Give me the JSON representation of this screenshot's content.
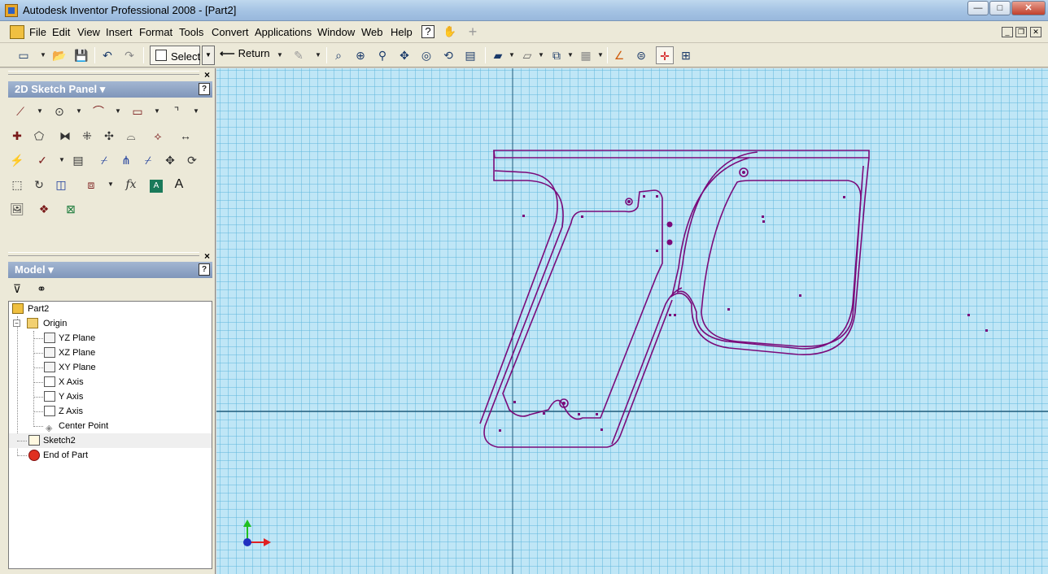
{
  "window": {
    "title": "Autodesk Inventor Professional 2008 - [Part2]",
    "controls": {
      "minimize": "—",
      "maximize": "□",
      "close": "✕"
    }
  },
  "menubar": {
    "items": [
      {
        "label": "File"
      },
      {
        "label": "Edit"
      },
      {
        "label": "View"
      },
      {
        "label": "Insert"
      },
      {
        "label": "Format"
      },
      {
        "label": "Tools"
      },
      {
        "label": "Convert"
      },
      {
        "label": "Applications"
      },
      {
        "label": "Window"
      },
      {
        "label": "Web"
      },
      {
        "label": "Help"
      }
    ],
    "help_icon": "?",
    "add_icon": "+",
    "mdi": {
      "minimize": "_",
      "restore": "❐",
      "close": "✕"
    }
  },
  "toolbar": {
    "select_label": "Select",
    "return_label": "Return"
  },
  "sketch_panel": {
    "title": "2D Sketch Panel",
    "help": "?",
    "close": "×"
  },
  "model_panel": {
    "title": "Model",
    "help": "?",
    "close": "×"
  },
  "tree": {
    "items": [
      {
        "label": "Part2"
      },
      {
        "label": "Origin"
      },
      {
        "label": "YZ Plane"
      },
      {
        "label": "XZ Plane"
      },
      {
        "label": "XY Plane"
      },
      {
        "label": "X Axis"
      },
      {
        "label": "Y Axis"
      },
      {
        "label": "Z Axis"
      },
      {
        "label": "Center Point"
      },
      {
        "label": "Sketch2"
      },
      {
        "label": "End of Part"
      }
    ]
  },
  "colors": {
    "grid_bg": "#bfe6f6",
    "grid_line": "#5fb6dc",
    "sketch": "#7a0a7a",
    "axis": "#1f5a7a"
  }
}
